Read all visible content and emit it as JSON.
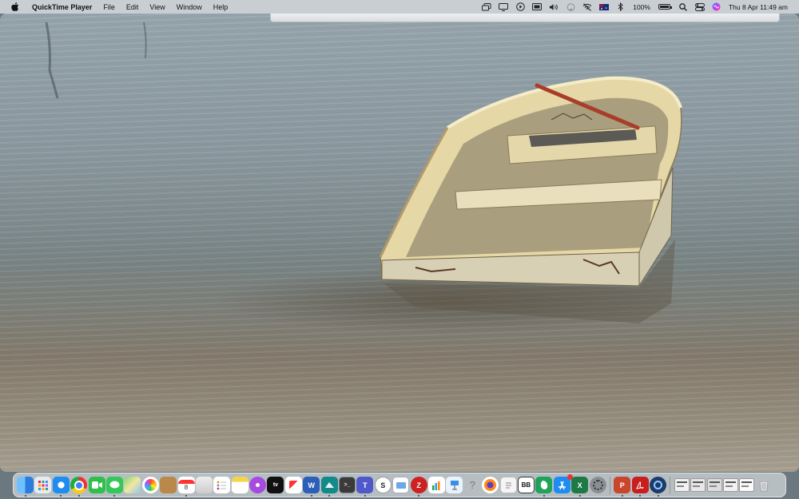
{
  "menubar": {
    "app_name": "QuickTime Player",
    "menus": [
      "File",
      "Edit",
      "View",
      "Window",
      "Help"
    ],
    "battery_percent": "100%",
    "datetime": "Thu 8 Apr  11:49 am"
  },
  "dock": {
    "calendar_day": "8",
    "tv_label": "tv",
    "word_label": "W",
    "excel_label": "X",
    "powerpoint_label": "P",
    "bb_label": "BB",
    "zotero_label": "Z",
    "scrivener_label": "S",
    "teams_label": "T",
    "help_label": "?"
  },
  "colors": {
    "menubar_bg": "#c9ced3",
    "dock_bg": "#c8cdd0",
    "boat_hull": "#e8d9a8"
  }
}
